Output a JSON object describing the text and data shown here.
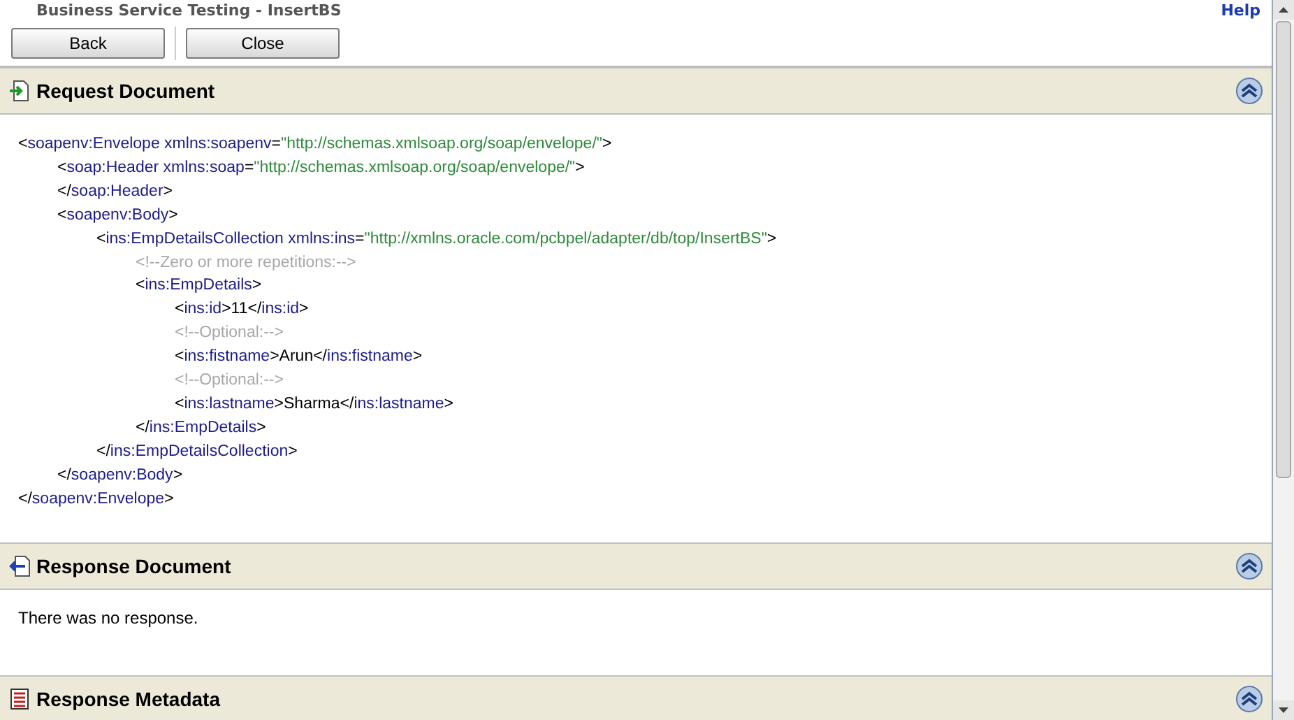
{
  "window": {
    "title": "Business Service Testing - InsertBS",
    "help": "Help"
  },
  "toolbar": {
    "buttons": [
      "Back",
      "Close"
    ]
  },
  "sections": [
    {
      "title": "Request Document",
      "kind": "request",
      "expanded": true,
      "xml": [
        {
          "tokens": [
            {
              "kind": "p",
              "text": "<"
            },
            {
              "kind": "tag",
              "text": "soapenv:Envelope"
            },
            {
              "kind": "attr",
              "text": " xmlns:soapenv"
            },
            {
              "kind": "p",
              "text": "="
            },
            {
              "kind": "val",
              "text": "\"http://schemas.xmlsoap.org/soap/envelope/\""
            },
            {
              "kind": "p",
              "text": ">"
            }
          ],
          "children": [
            {
              "tokens": [
                {
                  "kind": "p",
                  "text": "<"
                },
                {
                  "kind": "tag",
                  "text": "soap:Header"
                },
                {
                  "kind": "attr",
                  "text": " xmlns:soap"
                },
                {
                  "kind": "p",
                  "text": "="
                },
                {
                  "kind": "val",
                  "text": "\"http://schemas.xmlsoap.org/soap/envelope/\""
                },
                {
                  "kind": "p",
                  "text": ">"
                }
              ]
            },
            {
              "tokens": [
                {
                  "kind": "p",
                  "text": "</"
                },
                {
                  "kind": "tag",
                  "text": "soap:Header"
                },
                {
                  "kind": "p",
                  "text": ">"
                }
              ]
            },
            {
              "tokens": [
                {
                  "kind": "p",
                  "text": "<"
                },
                {
                  "kind": "tag",
                  "text": "soapenv:Body"
                },
                {
                  "kind": "p",
                  "text": ">"
                }
              ],
              "children": [
                {
                  "tokens": [
                    {
                      "kind": "p",
                      "text": "<"
                    },
                    {
                      "kind": "tag",
                      "text": "ins:EmpDetailsCollection"
                    },
                    {
                      "kind": "attr",
                      "text": " xmlns:ins"
                    },
                    {
                      "kind": "p",
                      "text": "="
                    },
                    {
                      "kind": "val",
                      "text": "\"http://xmlns.oracle.com/pcbpel/adapter/db/top/InsertBS\""
                    },
                    {
                      "kind": "p",
                      "text": ">"
                    }
                  ],
                  "children": [
                    {
                      "tokens": [
                        {
                          "kind": "comment",
                          "text": "<!--Zero or more repetitions:-->"
                        }
                      ]
                    },
                    {
                      "tokens": [
                        {
                          "kind": "p",
                          "text": "<"
                        },
                        {
                          "kind": "tag",
                          "text": "ins:EmpDetails"
                        },
                        {
                          "kind": "p",
                          "text": ">"
                        }
                      ],
                      "children": [
                        {
                          "tokens": [
                            {
                              "kind": "p",
                              "text": "<"
                            },
                            {
                              "kind": "tag",
                              "text": "ins:id"
                            },
                            {
                              "kind": "p",
                              "text": ">"
                            },
                            {
                              "kind": "text",
                              "text": "11"
                            },
                            {
                              "kind": "p",
                              "text": "</"
                            },
                            {
                              "kind": "tag",
                              "text": "ins:id"
                            },
                            {
                              "kind": "p",
                              "text": ">"
                            }
                          ]
                        },
                        {
                          "tokens": [
                            {
                              "kind": "comment",
                              "text": "<!--Optional:-->"
                            }
                          ]
                        },
                        {
                          "tokens": [
                            {
                              "kind": "p",
                              "text": "<"
                            },
                            {
                              "kind": "tag",
                              "text": "ins:fistname"
                            },
                            {
                              "kind": "p",
                              "text": ">"
                            },
                            {
                              "kind": "text",
                              "text": "Arun"
                            },
                            {
                              "kind": "p",
                              "text": "</"
                            },
                            {
                              "kind": "tag",
                              "text": "ins:fistname"
                            },
                            {
                              "kind": "p",
                              "text": ">"
                            }
                          ]
                        },
                        {
                          "tokens": [
                            {
                              "kind": "comment",
                              "text": "<!--Optional:-->"
                            }
                          ]
                        },
                        {
                          "tokens": [
                            {
                              "kind": "p",
                              "text": "<"
                            },
                            {
                              "kind": "tag",
                              "text": "ins:lastname"
                            },
                            {
                              "kind": "p",
                              "text": ">"
                            },
                            {
                              "kind": "text",
                              "text": "Sharma"
                            },
                            {
                              "kind": "p",
                              "text": "</"
                            },
                            {
                              "kind": "tag",
                              "text": "ins:lastname"
                            },
                            {
                              "kind": "p",
                              "text": ">"
                            }
                          ]
                        }
                      ]
                    },
                    {
                      "tokens": [
                        {
                          "kind": "p",
                          "text": "</"
                        },
                        {
                          "kind": "tag",
                          "text": "ins:EmpDetails"
                        },
                        {
                          "kind": "p",
                          "text": ">"
                        }
                      ]
                    }
                  ]
                },
                {
                  "tokens": [
                    {
                      "kind": "p",
                      "text": "</"
                    },
                    {
                      "kind": "tag",
                      "text": "ins:EmpDetailsCollection"
                    },
                    {
                      "kind": "p",
                      "text": ">"
                    }
                  ]
                }
              ]
            },
            {
              "tokens": [
                {
                  "kind": "p",
                  "text": "</"
                },
                {
                  "kind": "tag",
                  "text": "soapenv:Body"
                },
                {
                  "kind": "p",
                  "text": ">"
                }
              ]
            }
          ]
        },
        {
          "tokens": [
            {
              "kind": "p",
              "text": "</"
            },
            {
              "kind": "tag",
              "text": "soapenv:Envelope"
            },
            {
              "kind": "p",
              "text": ">"
            }
          ]
        }
      ]
    },
    {
      "title": "Response Document",
      "kind": "response",
      "expanded": true,
      "message": "There was no response."
    },
    {
      "title": "Response Metadata",
      "kind": "metadata",
      "expanded": true
    }
  ]
}
